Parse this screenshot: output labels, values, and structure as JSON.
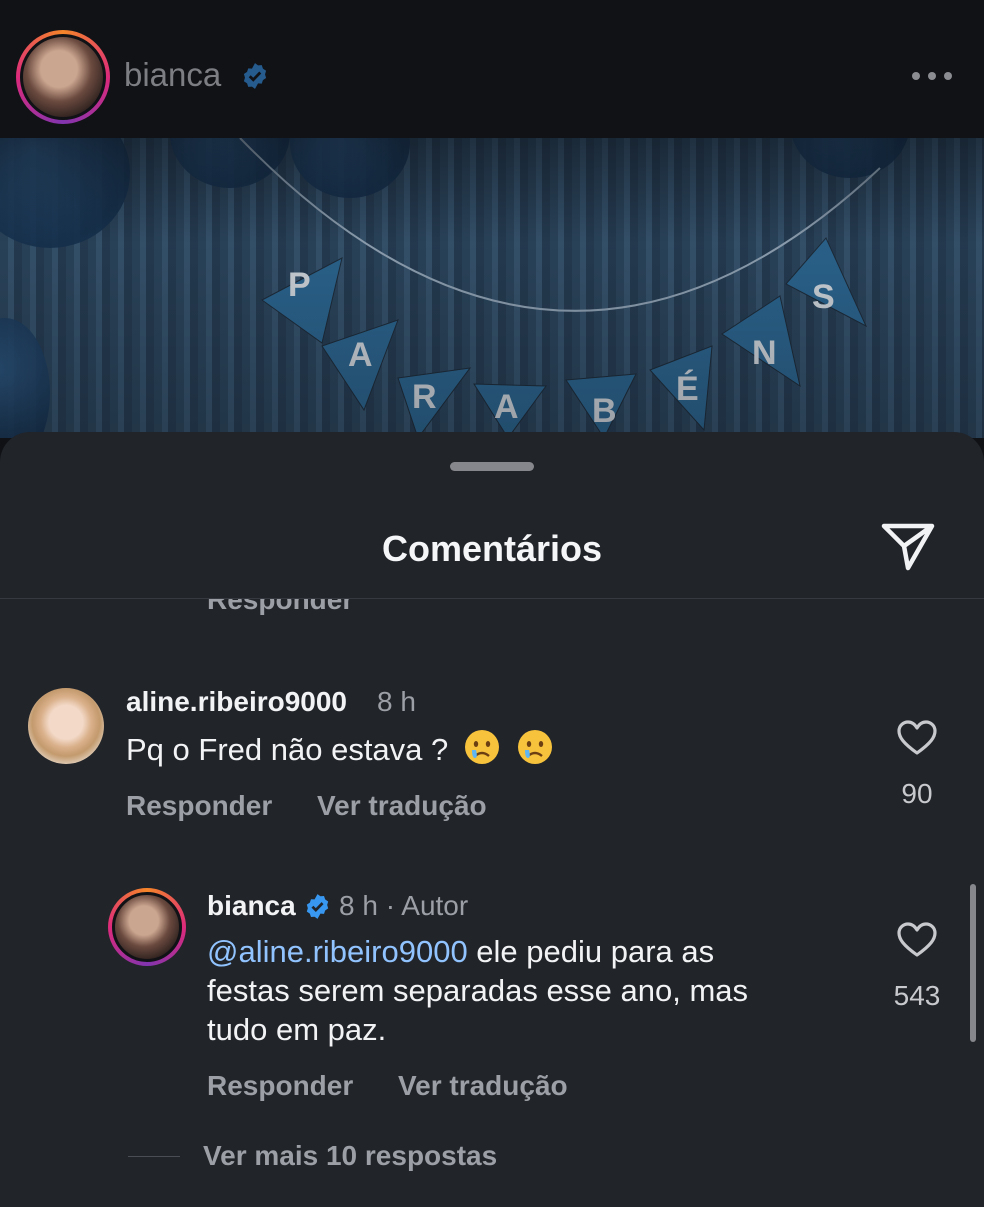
{
  "header": {
    "username": "bianca",
    "verified": true,
    "more_icon": "more-horizontal-icon"
  },
  "photo": {
    "banner_letters": [
      "P",
      "A",
      "R",
      "A",
      "B",
      "É",
      "N",
      "S"
    ]
  },
  "sheet": {
    "title": "Comentários",
    "share_icon": "paper-plane-icon",
    "clipped_reply_label": "Responder"
  },
  "comments": [
    {
      "username": "aline.ribeiro9000",
      "time": "8 h",
      "text": "Pq o Fred não estava ?",
      "emojis": [
        "crying-face",
        "crying-face"
      ],
      "reply_label": "Responder",
      "translate_label": "Ver tradução",
      "likes": "90"
    }
  ],
  "reply": {
    "username": "bianca",
    "verified": true,
    "meta": "8 h · Autor",
    "mention": "@aline.ribeiro9000",
    "text_line1": " ele pediu para as",
    "text_line2": "festas serem separadas esse ano, mas",
    "text_line3": "tudo em paz.",
    "reply_label": "Responder",
    "translate_label": "Ver tradução",
    "likes": "543"
  },
  "more_replies_label": "Ver mais 10 respostas",
  "colors": {
    "background": "#212429",
    "mention": "#91c3ff",
    "verified": "#3897f0",
    "muted_text": "#9c9fa5"
  }
}
